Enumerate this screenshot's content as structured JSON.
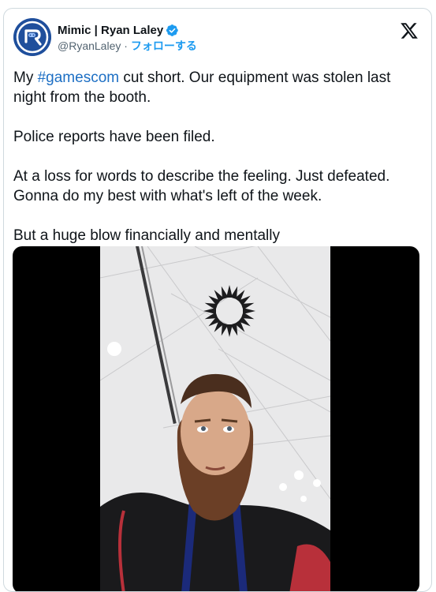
{
  "author": {
    "display_name": "Mimic | Ryan Laley",
    "handle": "@RyanLaley",
    "separator": "·",
    "follow_label": "フォローする",
    "verified": true
  },
  "icons": {
    "avatar": "avatar-logo",
    "verified": "verified-badge-icon",
    "brand": "x-logo-icon"
  },
  "tweet": {
    "line1_prefix": "My ",
    "hashtag": "#gamescom",
    "line1_suffix": " cut short. Our equipment was stolen last night from the booth.",
    "para2": "Police reports have been filed.",
    "para3": "At a loss for words to describe the feeling. Just defeated. Gonna do my best with what's left of the week.",
    "para4": "But a huge blow financially and mentally"
  },
  "colors": {
    "link": "#1d9bf0",
    "hashtag": "#1d6fc4",
    "text": "#0f1419",
    "secondary": "#536471",
    "border": "#cfd9de",
    "avatar_bg": "#2b5aa8"
  }
}
